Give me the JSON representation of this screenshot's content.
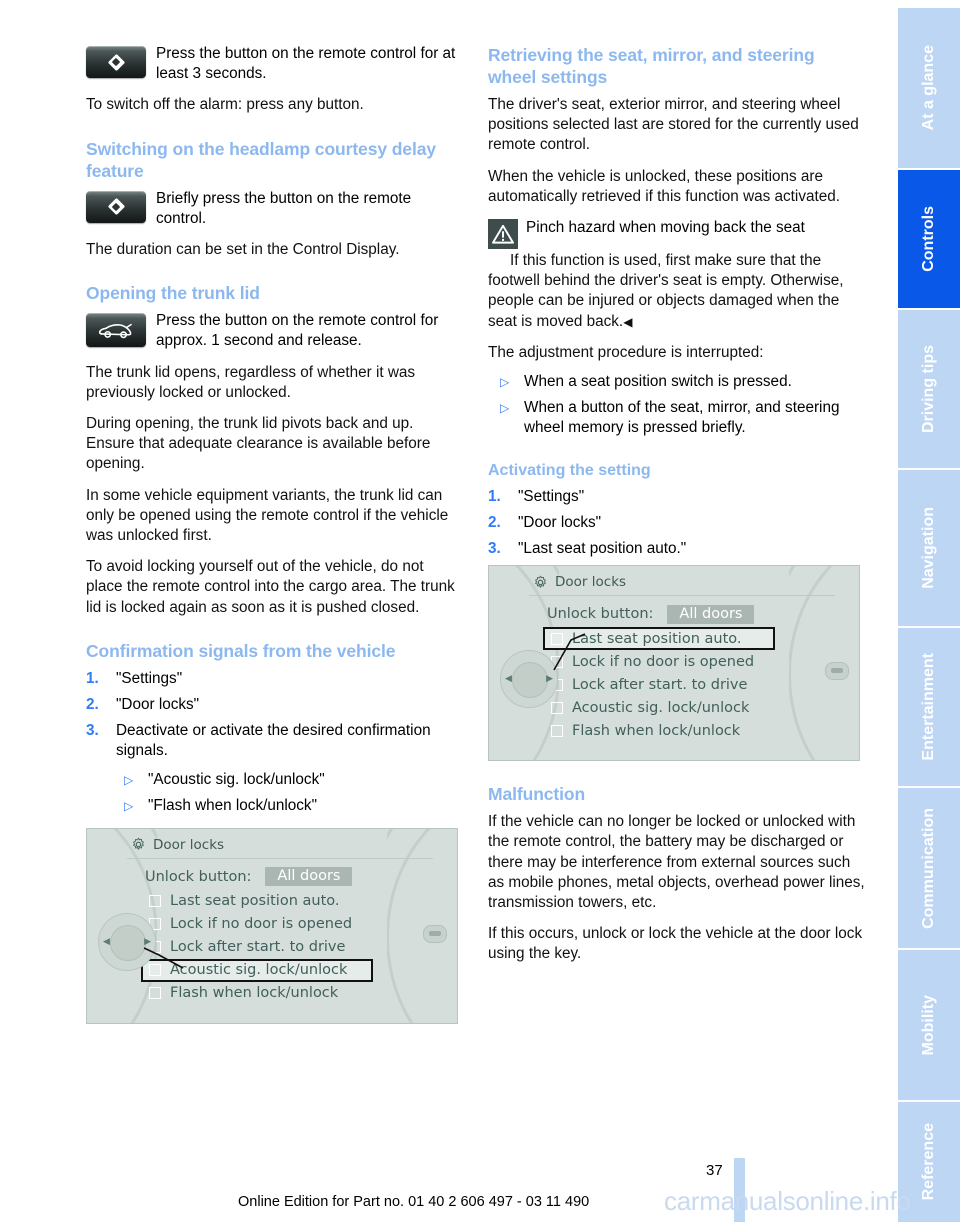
{
  "page": {
    "number": "37",
    "footer_note": "Online Edition for Part no. 01 40 2 606 497 - 03 11 490",
    "watermark": "carmanualsonline.info"
  },
  "colors": {
    "heading_blue": "#8cb8ef",
    "accent_blue": "#2f7cf6",
    "tab_inactive": "#bcd6f4",
    "tab_active": "#0a58e8",
    "screen_bg": "#d6dedb",
    "screen_text": "#41605b"
  },
  "left_column": {
    "intro_icon_text": "Press the button on the remote control for at least 3 seconds.",
    "alarm_off": "To switch off the alarm: press any button.",
    "headlamp": {
      "heading": "Switching on the headlamp courtesy delay feature",
      "icon_text": "Briefly press the button on the remote control.",
      "duration": "The duration can be set in the Control Display."
    },
    "trunk": {
      "heading": "Opening the trunk lid",
      "icon_text": "Press the button on the remote control for approx. 1 second and release.",
      "p1": "The trunk lid opens, regardless of whether it was previously locked or unlocked.",
      "p2": "During opening, the trunk lid pivots back and up. Ensure that adequate clearance is available before opening.",
      "p3": "In some vehicle equipment variants, the trunk lid can only be opened using the remote control if the vehicle was unlocked first.",
      "p4": "To avoid locking yourself out of the vehicle, do not place the remote control into the cargo area. The trunk lid is locked again as soon as it is pushed closed."
    },
    "confirmation": {
      "heading": "Confirmation signals from the vehicle",
      "steps": [
        {
          "num": "1.",
          "text": "\"Settings\""
        },
        {
          "num": "2.",
          "text": "\"Door locks\""
        },
        {
          "num": "3.",
          "text": "Deactivate or activate the desired confirmation signals."
        }
      ],
      "sub_bullets": [
        "\"Acoustic sig. lock/unlock\"",
        "\"Flash when lock/unlock\""
      ]
    }
  },
  "right_column": {
    "retrieving": {
      "heading": "Retrieving the seat, mirror, and steering wheel settings",
      "p1": "The driver's seat, exterior mirror, and steering wheel positions selected last are stored for the currently used remote control.",
      "p2": "When the vehicle is unlocked, these positions are automatically retrieved if this function was activated."
    },
    "warning": {
      "title": "Pinch hazard when moving back the seat",
      "body": "If this function is used, first make sure that the footwell behind the driver's seat is empty. Otherwise, people can be injured or objects damaged when the seat is moved back.",
      "end_mark": "◀"
    },
    "interrupt": {
      "lead": "The adjustment procedure is interrupted:",
      "bullets": [
        "When a seat position switch is pressed.",
        "When a button of the seat, mirror, and steering wheel memory is pressed briefly."
      ]
    },
    "activating": {
      "heading": "Activating the setting",
      "steps": [
        {
          "num": "1.",
          "text": "\"Settings\""
        },
        {
          "num": "2.",
          "text": "\"Door locks\""
        },
        {
          "num": "3.",
          "text": "\"Last seat position auto.\""
        }
      ]
    },
    "malfunction": {
      "heading": "Malfunction",
      "p1": "If the vehicle can no longer be locked or unlocked with the remote control, the battery may be discharged or there may be interference from external sources such as mobile phones, metal objects, overhead power lines, transmission towers, etc.",
      "p2": "If this occurs, unlock or lock the vehicle at the door lock using the key."
    }
  },
  "figures": {
    "door_locks_screen": {
      "title": "Door locks",
      "unlock_label": "Unlock button:",
      "unlock_value": "All doors",
      "items": [
        "Last seat position auto.",
        "Lock if no door is opened",
        "Lock after start. to drive",
        "Acoustic sig. lock/unlock",
        "Flash when lock/unlock"
      ],
      "highlighted_left": "Acoustic sig. lock/unlock",
      "highlighted_right": "Last seat position auto."
    }
  },
  "sidebar": {
    "tabs": [
      {
        "label": "At a glance",
        "active": false
      },
      {
        "label": "Controls",
        "active": true
      },
      {
        "label": "Driving tips",
        "active": false
      },
      {
        "label": "Navigation",
        "active": false
      },
      {
        "label": "Entertainment",
        "active": false
      },
      {
        "label": "Communication",
        "active": false
      },
      {
        "label": "Mobility",
        "active": false
      },
      {
        "label": "Reference",
        "active": false
      }
    ]
  }
}
